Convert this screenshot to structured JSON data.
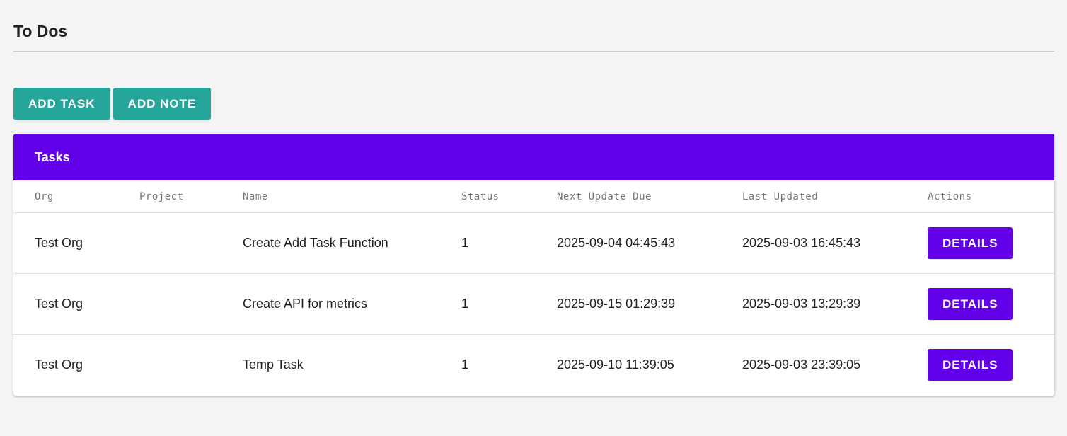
{
  "page": {
    "title": "To Dos"
  },
  "toolbar": {
    "add_task_label": "ADD TASK",
    "add_note_label": "ADD NOTE"
  },
  "tasks_card": {
    "title": "Tasks",
    "columns": [
      "Org",
      "Project",
      "Name",
      "Status",
      "Next Update Due",
      "Last Updated",
      "Actions"
    ],
    "rows": [
      {
        "org": "Test Org",
        "project": "",
        "name": "Create Add Task Function",
        "status": "1",
        "next_update_due": "2025-09-04 04:45:43",
        "last_updated": "2025-09-03 16:45:43",
        "action_label": "DETAILS"
      },
      {
        "org": "Test Org",
        "project": "",
        "name": "Create API for metrics",
        "status": "1",
        "next_update_due": "2025-09-15 01:29:39",
        "last_updated": "2025-09-03 13:29:39",
        "action_label": "DETAILS"
      },
      {
        "org": "Test Org",
        "project": "",
        "name": "Temp Task",
        "status": "1",
        "next_update_due": "2025-09-10 11:39:05",
        "last_updated": "2025-09-03 23:39:05",
        "action_label": "DETAILS"
      }
    ]
  },
  "colors": {
    "background": "#f4f4f4",
    "accent_teal": "#26a69a",
    "accent_purple": "#6200ea",
    "text": "#212121",
    "header_text_muted": "#757575"
  }
}
